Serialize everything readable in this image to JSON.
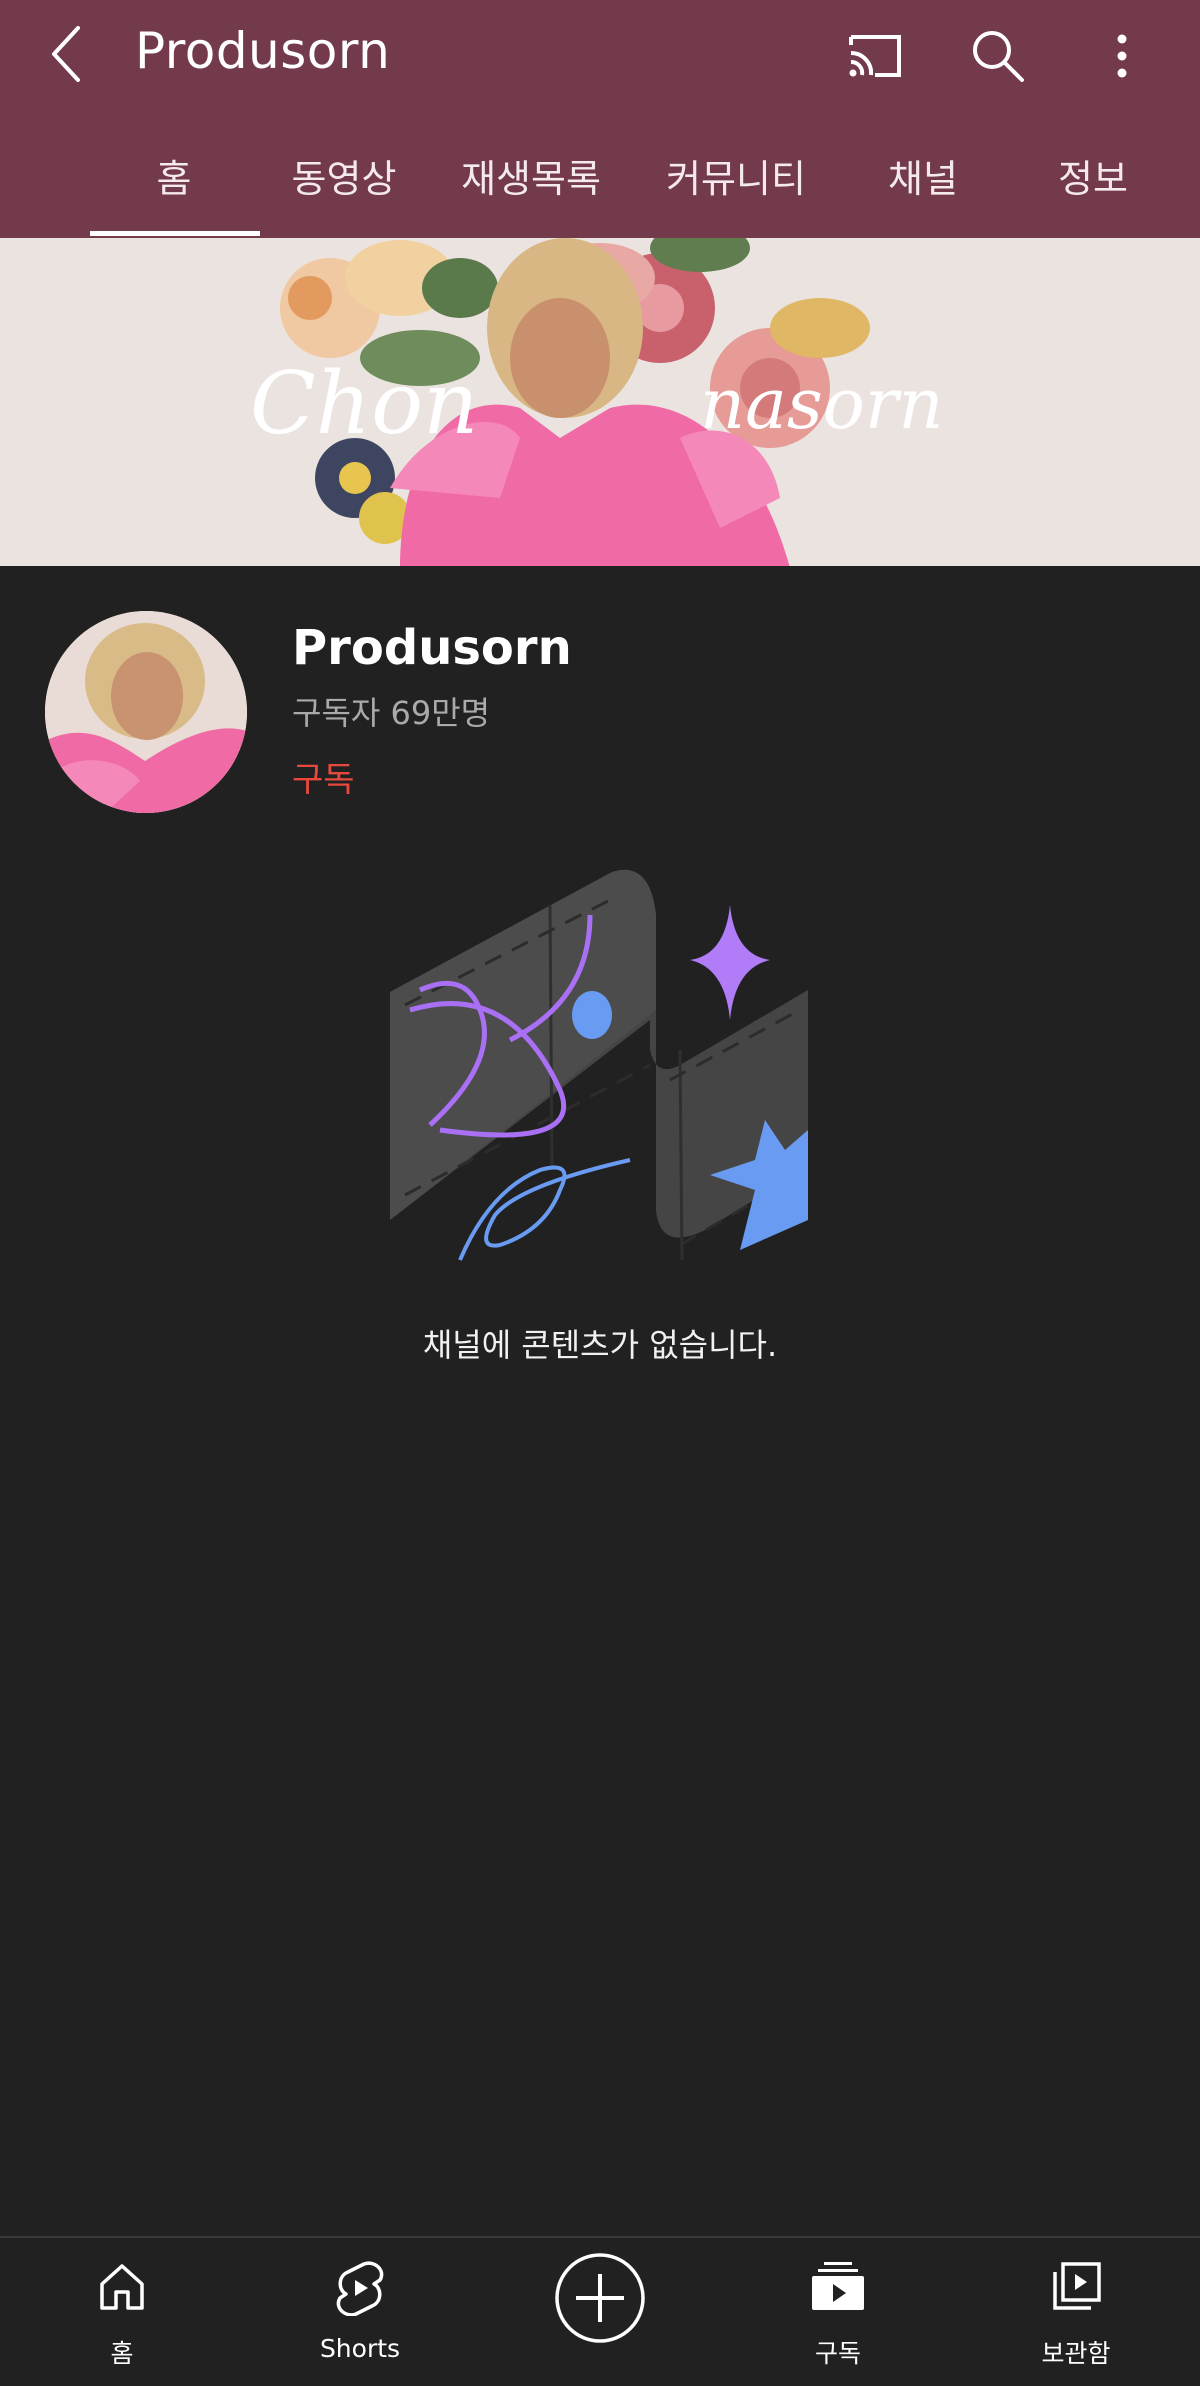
{
  "header": {
    "title": "Produsorn",
    "icons": [
      "back-arrow-icon",
      "cast-icon",
      "search-icon",
      "more-vert-icon"
    ],
    "background_color": "#733a4c"
  },
  "tabs": [
    {
      "label": "홈",
      "selected": true
    },
    {
      "label": "동영상"
    },
    {
      "label": "재생목록"
    },
    {
      "label": "커뮤니티"
    },
    {
      "label": "채널"
    },
    {
      "label": "정보"
    }
  ],
  "banner": {
    "text_left": "Chon",
    "text_right": "nasorn"
  },
  "channel": {
    "name": "Produsorn",
    "subscribers": "구독자 69만명",
    "subscribe_label": "구독",
    "subscribe_color": "#e8493e"
  },
  "empty_state": {
    "message": "채널에 콘텐츠가 없습니다."
  },
  "bottom_nav": [
    {
      "label": "홈",
      "icon": "home-icon"
    },
    {
      "label": "Shorts",
      "icon": "shorts-icon"
    },
    {
      "label": "",
      "icon": "create-plus-icon"
    },
    {
      "label": "구독",
      "icon": "subscriptions-icon"
    },
    {
      "label": "보관함",
      "icon": "library-icon"
    }
  ]
}
